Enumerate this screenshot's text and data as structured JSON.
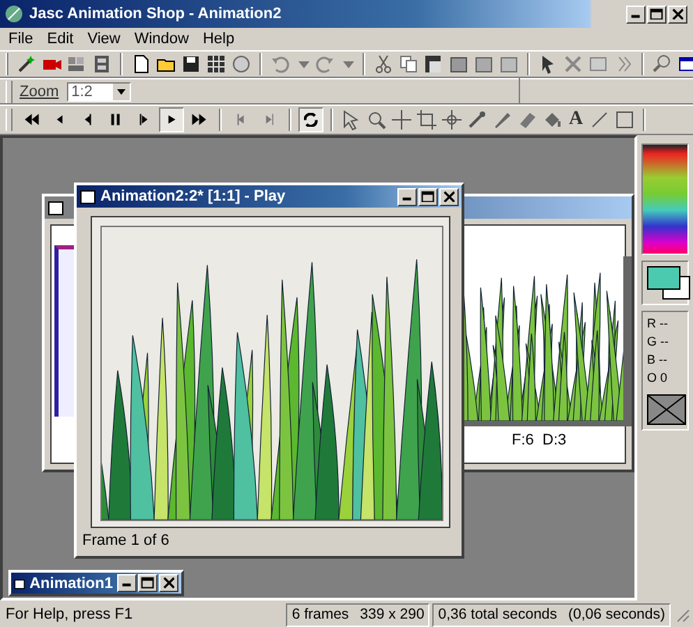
{
  "window": {
    "title": "Jasc Animation Shop - Animation2"
  },
  "menu": [
    {
      "label": "File"
    },
    {
      "label": "Edit"
    },
    {
      "label": "View"
    },
    {
      "label": "Window"
    },
    {
      "label": "Help"
    }
  ],
  "zoom": {
    "label": "Zoom",
    "value": "1:2"
  },
  "playback": [
    {
      "kind": "first",
      "pressed": false
    },
    {
      "kind": "prev",
      "pressed": false
    },
    {
      "kind": "back",
      "pressed": false
    },
    {
      "kind": "pause",
      "pressed": false
    },
    {
      "kind": "step",
      "pressed": false
    },
    {
      "kind": "play",
      "pressed": true
    },
    {
      "kind": "last",
      "pressed": false
    },
    {
      "kind": "frame-prev",
      "pressed": false
    },
    {
      "kind": "frame-next",
      "pressed": false
    },
    {
      "kind": "loop",
      "pressed": true
    }
  ],
  "text_tool": "A",
  "back_window": {
    "frame_info": "F:6  D:3"
  },
  "play_window": {
    "title": "Animation2:2* [1:1] - Play",
    "caption": "Frame 1 of 6"
  },
  "minimized_window": {
    "title": "Animation1"
  },
  "palette": {
    "readouts": [
      "R --",
      "G --",
      "B --",
      "O 0"
    ]
  },
  "status_bar": {
    "help": "For Help, press F1",
    "frames": "6 frames",
    "size": "339 x 290",
    "total": "0,36 total seconds",
    "frame_time": "(0,06 seconds)"
  }
}
